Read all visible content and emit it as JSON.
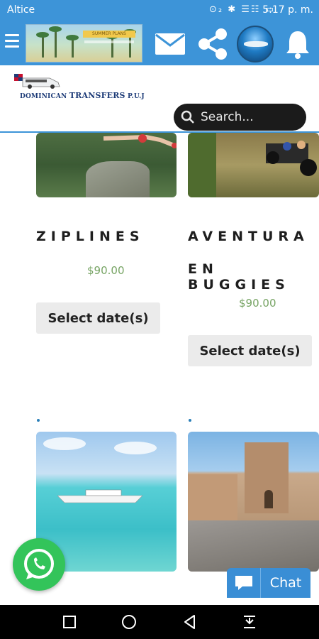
{
  "status_bar": {
    "carrier": "Altice",
    "icons": "⊙₂ ✱ ☰☷ ▭",
    "time": "5:17 p. m."
  },
  "app_bar": {
    "banner_tag": "SUMMER PLANS",
    "icons": [
      "menu-icon",
      "mail-icon",
      "share-icon",
      "avatar",
      "bell-icon"
    ],
    "color": "#3d94d8"
  },
  "logo": {
    "brand_pre": "DOMINICAN ",
    "brand_mid": "TRANSFERS",
    "brand_post": " P.U.J"
  },
  "search": {
    "placeholder": "Search..."
  },
  "products": [
    {
      "title_line1": "ZIPLINES",
      "price": "$90.00",
      "button": "Select date(s)"
    },
    {
      "title_line1": "AVENTURA",
      "title_line2": "EN BUGGIES",
      "price": "$90.00",
      "button": "Select date(s)"
    }
  ],
  "floating": {
    "chat_label": "Chat",
    "whatsapp_icon": "whatsapp-icon"
  },
  "nav_bar": {
    "buttons": [
      "recents-button",
      "home-button",
      "back-button",
      "notifications-pull-button"
    ]
  },
  "colors": {
    "primary": "#3d94d8",
    "price": "#77a464",
    "whatsapp": "#33c45a"
  }
}
